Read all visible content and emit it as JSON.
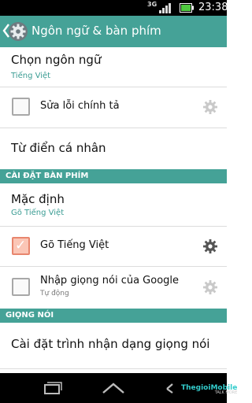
{
  "status_bar": {
    "network": "3G",
    "time": "23:38"
  },
  "action_bar": {
    "title": "Ngôn ngữ & bàn phím",
    "icon": "settings-gear-icon"
  },
  "items": {
    "language": {
      "title": "Chọn ngôn ngữ",
      "summary": "Tiếng Việt"
    },
    "spellcheck": {
      "title": "Sửa lỗi chính tả",
      "checked": false,
      "settings_enabled": false
    },
    "dictionary": {
      "title": "Từ điển cá nhân"
    },
    "default_keyboard": {
      "title": "Mặc định",
      "summary": "Gõ Tiếng Việt"
    },
    "vn_keyboard": {
      "title": "Gõ Tiếng Việt",
      "checked": true,
      "settings_enabled": true
    },
    "google_voice": {
      "title": "Nhập giọng nói của Google",
      "summary": "Tự động",
      "checked": false,
      "settings_enabled": false
    },
    "voice_recognizer": {
      "title": "Cài đặt trình nhận dạng giọng nói"
    }
  },
  "sections": {
    "keyboard": "CÀI ĐẶT BÀN PHÍM",
    "voice": "GIỌNG NÓI"
  },
  "watermark": {
    "brand": "ThegioiMobile",
    "tagline": "TALK MORE"
  },
  "colors": {
    "accent": "#45a297",
    "checkbox_checked": "#fbc6b6"
  }
}
